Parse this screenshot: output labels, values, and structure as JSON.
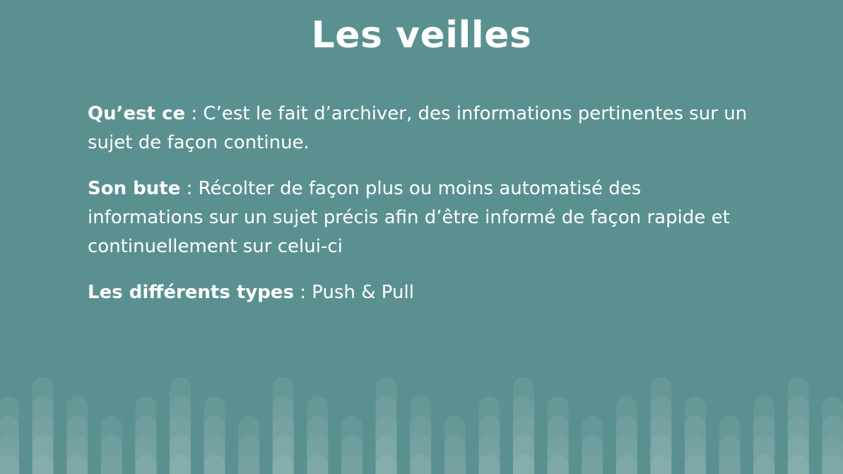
{
  "slide": {
    "title": "Les veilles",
    "paragraphs": [
      {
        "term": "Qu’est ce",
        "separator": " : ",
        "text": "C’est le fait d’archiver, des informations pertinentes sur un sujet de façon continue."
      },
      {
        "term": "Son bute",
        "separator": " : ",
        "text": "Récolter de façon plus ou moins automatisé des informations sur un sujet précis afin d’être informé de façon rapide et continuellement sur celui-ci"
      },
      {
        "term": "Les différents types",
        "separator": " : ",
        "text": "Push & Pull"
      }
    ]
  },
  "colors": {
    "background": "#5a9190",
    "text": "#ffffff",
    "decoration": "#ffffff"
  }
}
